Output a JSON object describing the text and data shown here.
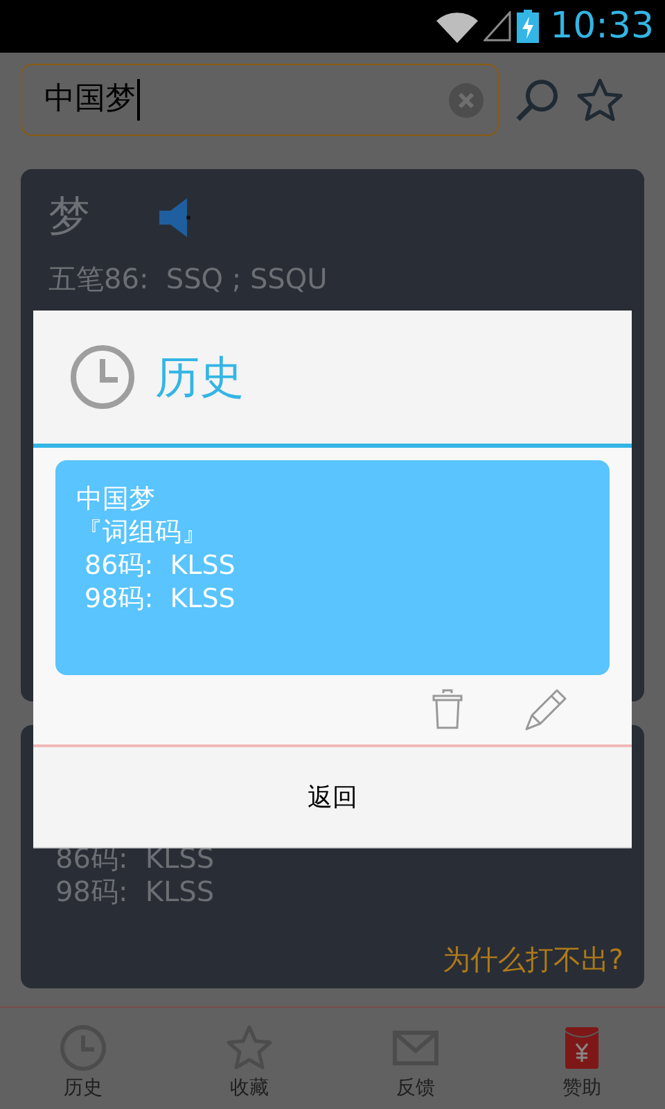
{
  "status_bar": {
    "time": "10:33"
  },
  "search": {
    "value": "中国梦"
  },
  "result_card": {
    "character": "梦",
    "codes": [
      "五笔86:  SSQ ; SSQU"
    ]
  },
  "phrase_card": {
    "codes": [
      "86码:  KLSS",
      "98码:  KLSS"
    ],
    "help_link": "为什么打不出?"
  },
  "dialog": {
    "title": "历史",
    "entries": [
      {
        "lines": [
          "中国梦",
          "『词组码』",
          " 86码:  KLSS",
          " 98码:  KLSS"
        ]
      }
    ],
    "button": "返回"
  },
  "nav": [
    {
      "kind": "clock",
      "label": "历史"
    },
    {
      "kind": "star",
      "label": "收藏"
    },
    {
      "kind": "mail",
      "label": "反馈"
    },
    {
      "kind": "envelope",
      "label": "赞助"
    }
  ]
}
